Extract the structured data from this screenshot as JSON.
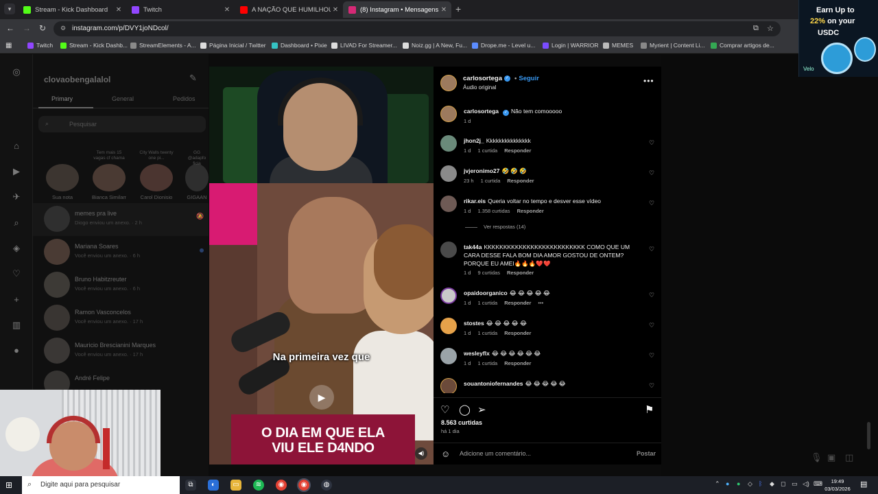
{
  "browser": {
    "tabs": [
      {
        "title": "Stream - Kick Dashboard",
        "favicon_color": "#53fc18"
      },
      {
        "title": "Twitch",
        "favicon_color": "#9146ff"
      },
      {
        "title": "A NAÇÃO QUE HUMILHOU OS",
        "favicon_color": "#ff0000"
      },
      {
        "title": "(8) Instagram • Mensagens",
        "favicon_color": "#d62976"
      }
    ],
    "url": "instagram.com/p/DVY1joNDcol/",
    "bookmarks": [
      {
        "label": "Twitch",
        "color": "#9146ff"
      },
      {
        "label": "Stream - Kick Dashb...",
        "color": "#53fc18"
      },
      {
        "label": "StreamElements - A...",
        "color": "#8a8a8a"
      },
      {
        "label": "Página Inicial / Twitter",
        "color": "#dddddd"
      },
      {
        "label": "Dashboard • Pixie",
        "color": "#35c3c3"
      },
      {
        "label": "LIVAD For Streamer...",
        "color": "#dddddd"
      },
      {
        "label": "Noiz.gg | A New, Fu...",
        "color": "#dddddd"
      },
      {
        "label": "Drope.me - Level u...",
        "color": "#5b8cff"
      },
      {
        "label": "Login | WARRIOR",
        "color": "#7a4cff"
      },
      {
        "label": "MEMES",
        "color": "#bbbbbb"
      },
      {
        "label": "Myrient | Content Li...",
        "color": "#888888"
      },
      {
        "label": "Comprar artigos de...",
        "color": "#34a853"
      }
    ]
  },
  "ad": {
    "line1": "Earn Up to",
    "line2_pct": "22%",
    "line2_rest": " on your",
    "line3": "USDC",
    "brand": "Velo"
  },
  "dm": {
    "username": "clovaobengalalol",
    "tabs": [
      "Primary",
      "General",
      "Pedidos"
    ],
    "search_placeholder": "Pesquisar",
    "stories": [
      {
        "note": "",
        "name": "Sua nota"
      },
      {
        "note": "Tem mais 15 vagas cf chama",
        "name": "Bianca Similamo..."
      },
      {
        "note": "City Walls twenty one pi...",
        "name": "Carol Dionisio"
      },
      {
        "note": "GG @adapfo ficia",
        "name": "GIGAAN"
      }
    ],
    "conversations": [
      {
        "name": "memes pra live",
        "sub": "Diogo enviou um anexo. · 2 h"
      },
      {
        "name": "Mariana Soares",
        "sub": "Você enviou um anexo. · 6 h"
      },
      {
        "name": "Bruno Habitzreuter",
        "sub": "Você enviou um anexo. · 6 h"
      },
      {
        "name": "Ramon Vasconcelos",
        "sub": "Você enviou um anexo. · 17 h"
      },
      {
        "name": "Mauricio Brescianini Marques",
        "sub": "Você enviou um anexo. · 17 h"
      },
      {
        "name": "André Felipe",
        "sub": ""
      }
    ]
  },
  "reel": {
    "caption_top": "Na primeira vez que",
    "banner_line1": "O DIA EM QUE ELA",
    "banner_line2": "VIU ELE D4NDO",
    "author": "carlosortega",
    "follow": "Seguir",
    "audio": "Áudio original",
    "comments": [
      {
        "user": "carlosortega",
        "text": "Não tem comooooo",
        "time": "1 d",
        "likes": "",
        "reply": "",
        "verified": true,
        "heart": false
      },
      {
        "user": "jhon2j_",
        "text": "Kkkkkkkkkkkkkkk",
        "time": "1 d",
        "likes": "1 curtida",
        "reply": "Responder",
        "verified": false,
        "heart": true
      },
      {
        "user": "jvjeronimo27",
        "text": "🤣 🤣 🤣",
        "time": "23 h",
        "likes": "1 curtida",
        "reply": "Responder",
        "verified": false,
        "heart": true
      },
      {
        "user": "rikar.eis",
        "text": "Queria voltar no tempo e desver esse vídeo",
        "time": "1 d",
        "likes": "1.358 curtidas",
        "reply": "Responder",
        "verified": false,
        "heart": true
      },
      {
        "user": "tak44a",
        "text": "KKKKKKKKKKKKKKKKKKKKKKKKKK COMO QUE UM CARA DESSE FALA BOM DIA AMOR GOSTOU DE ONTEM? PORQUE EU AMEI🔥🔥🔥❤️❤️",
        "time": "1 d",
        "likes": "9 curtidas",
        "reply": "Responder",
        "verified": false,
        "heart": true
      },
      {
        "user": "opaidoorganico",
        "text": "😂 😂 😂 😂 😂",
        "time": "1 d",
        "likes": "1 curtida",
        "reply": "Responder",
        "verified": false,
        "heart": true
      },
      {
        "user": "stostes",
        "text": "😂 😂 😂 😂 😂",
        "time": "1 d",
        "likes": "1 curtida",
        "reply": "Responder",
        "verified": false,
        "heart": true
      },
      {
        "user": "wesleyflx",
        "text": "😂 😂 😂 😂 😂 😂",
        "time": "1 d",
        "likes": "1 curtida",
        "reply": "Responder",
        "verified": false,
        "heart": true
      },
      {
        "user": "souantoniofernandes",
        "text": "😂 😂 😂 😂 😂",
        "time": "",
        "likes": "",
        "reply": "",
        "verified": false,
        "heart": true
      }
    ],
    "view_replies": "Ver respostas (14)",
    "like_count": "8.563 curtidas",
    "posted": "há 1 dia",
    "add_comment_placeholder": "Adicione um comentário...",
    "post_label": "Postar"
  },
  "taskbar": {
    "search_placeholder": "Digite aqui para pesquisar",
    "time": "19:49",
    "date": "03/03/2026"
  }
}
